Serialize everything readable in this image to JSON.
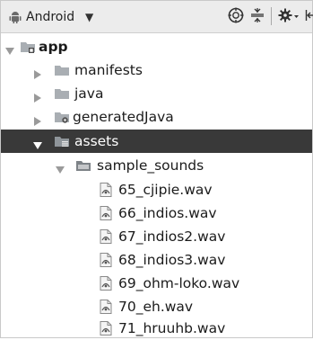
{
  "toolbar": {
    "view_label": "Android",
    "icons": [
      "android-icon",
      "chevron-down-icon",
      "sync-icon",
      "collapse-all-icon",
      "gear-icon",
      "hide-panel-icon"
    ]
  },
  "tree": {
    "root": {
      "label": "app",
      "expanded": true,
      "bold": true
    },
    "items": [
      {
        "label": "manifests",
        "expanded": false
      },
      {
        "label": "java",
        "expanded": false
      },
      {
        "label": "generatedJava",
        "expanded": false
      },
      {
        "label": "assets",
        "expanded": true,
        "selected": true
      },
      {
        "label": "sample_sounds",
        "expanded": true
      }
    ],
    "files": [
      "65_cjipie.wav",
      "66_indios.wav",
      "67_indios2.wav",
      "68_indios3.wav",
      "69_ohm-loko.wav",
      "70_eh.wav",
      "71_hruuhb.wav"
    ]
  },
  "colors": {
    "selection_bg": "#393939",
    "folder": "#a9aeb3",
    "toolbar_bg": "#ececec"
  }
}
